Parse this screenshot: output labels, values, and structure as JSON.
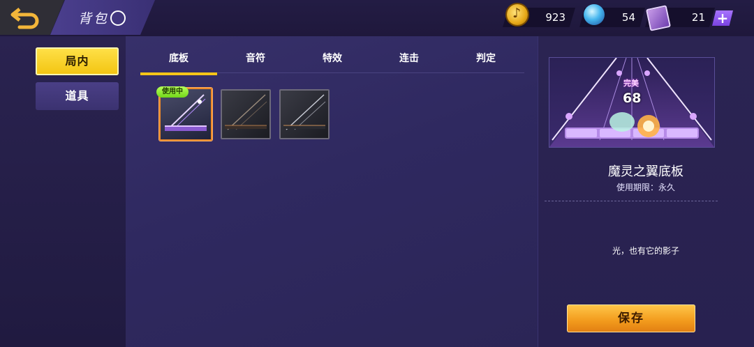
{
  "header": {
    "title": "背包",
    "info_icon": "ⓘ",
    "currencies": [
      {
        "icon": "music-coin-icon",
        "value": "923"
      },
      {
        "icon": "diamond-gem-icon",
        "value": "54"
      },
      {
        "icon": "ticket-icon",
        "value": "21"
      }
    ],
    "plus_label": "+"
  },
  "sidebar": {
    "items": [
      {
        "label": "局内",
        "active": true
      },
      {
        "label": "道具",
        "active": false
      }
    ]
  },
  "tabs": [
    {
      "label": "底板",
      "active": true
    },
    {
      "label": "音符",
      "active": false
    },
    {
      "label": "特效",
      "active": false
    },
    {
      "label": "连击",
      "active": false
    },
    {
      "label": "判定",
      "active": false
    }
  ],
  "inventory": {
    "in_use_badge": "使用中",
    "items": [
      {
        "name": "board-item-1",
        "selected": true
      },
      {
        "name": "board-item-2",
        "selected": false
      },
      {
        "name": "board-item-3",
        "selected": false
      }
    ]
  },
  "detail": {
    "preview_judgement": "完美",
    "preview_combo": "68",
    "name": "魔灵之翼底板",
    "expiry": "使用期限：永久",
    "description": "光，也有它的影子",
    "save_label": "保存"
  },
  "colors": {
    "accent_yellow": "#f5c518",
    "save_orange": "#f29a1c",
    "in_use_green": "#8ee82a",
    "selected_border": "#f08a2a"
  }
}
